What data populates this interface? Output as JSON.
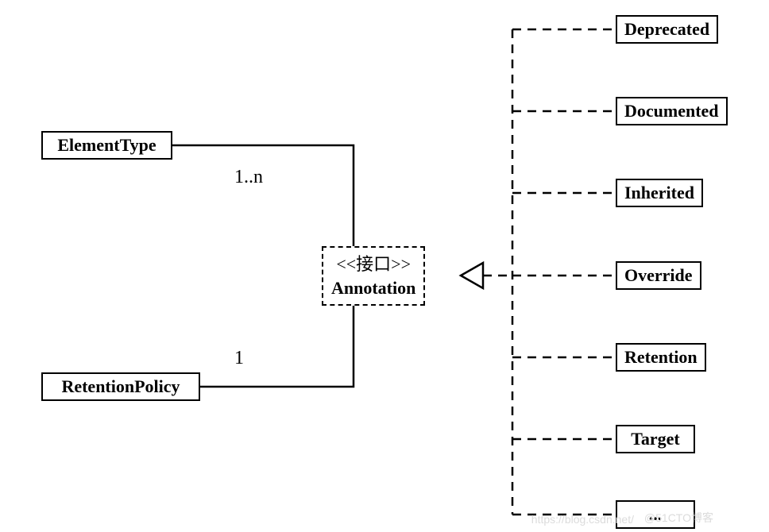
{
  "interface": {
    "stereotype": "<<接口>>",
    "name": "Annotation"
  },
  "left": {
    "elementType": "ElementType",
    "retentionPolicy": "RetentionPolicy",
    "mult_top": "1..n",
    "mult_bottom": "1"
  },
  "right": [
    "Deprecated",
    "Documented",
    "Inherited",
    "Override",
    "Retention",
    "Target",
    "..."
  ],
  "watermark1": "https://blog.csdn.net/",
  "watermark2": "@51CTO博客"
}
